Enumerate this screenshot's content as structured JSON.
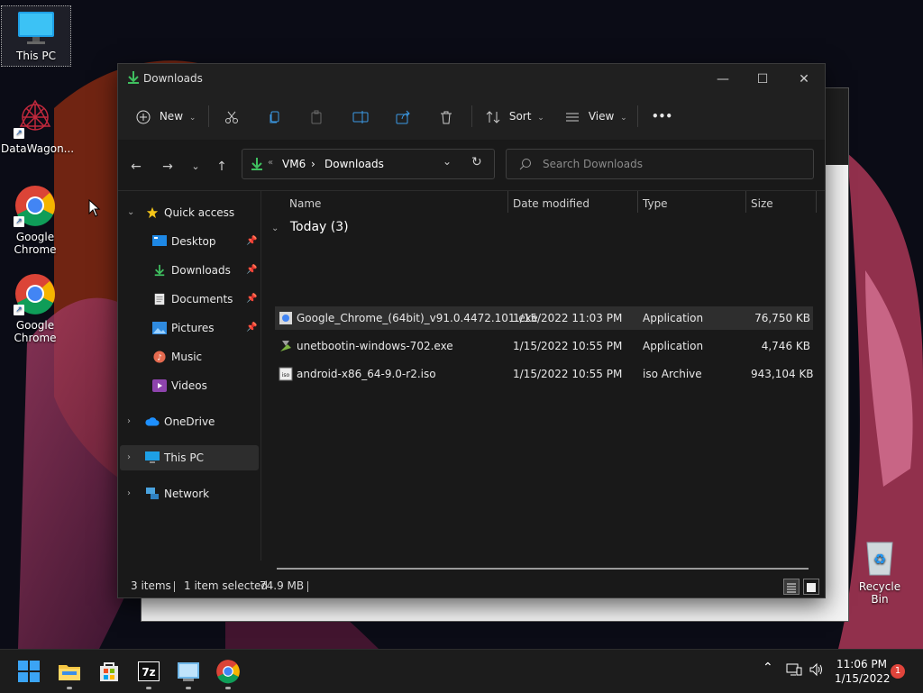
{
  "desktop": {
    "icons": [
      {
        "label": "This PC"
      },
      {
        "label": "DataWagon..."
      },
      {
        "label": "Google Chrome"
      },
      {
        "label": "Google Chrome"
      },
      {
        "label": "Recycle Bin"
      }
    ]
  },
  "window": {
    "title": "Downloads",
    "controls": {
      "minimize": "—",
      "maximize": "☐",
      "close": "✕"
    }
  },
  "toolbar": {
    "new_label": "New",
    "sort_label": "Sort",
    "view_label": "View",
    "more_label": "•••"
  },
  "address": {
    "crumbs": [
      "VM6",
      "Downloads"
    ],
    "separator": "›",
    "overflow": "«"
  },
  "search": {
    "placeholder": "Search Downloads"
  },
  "sidebar": {
    "quick_access": "Quick access",
    "items": [
      {
        "label": "Desktop",
        "pinned": true
      },
      {
        "label": "Downloads",
        "pinned": true
      },
      {
        "label": "Documents",
        "pinned": true
      },
      {
        "label": "Pictures",
        "pinned": true
      },
      {
        "label": "Music",
        "pinned": false
      },
      {
        "label": "Videos",
        "pinned": false
      }
    ],
    "onedrive": "OneDrive",
    "this_pc": "This PC",
    "network": "Network"
  },
  "columns": {
    "name": "Name",
    "date": "Date modified",
    "type": "Type",
    "size": "Size"
  },
  "group": {
    "label": "Today (3)"
  },
  "files": [
    {
      "name": "Google_Chrome_(64bit)_v91.0.4472.101.exe",
      "date": "1/15/2022 11:03 PM",
      "type": "Application",
      "size": "76,750 KB",
      "selected": true
    },
    {
      "name": "unetbootin-windows-702.exe",
      "date": "1/15/2022 10:55 PM",
      "type": "Application",
      "size": "4,746 KB",
      "selected": false
    },
    {
      "name": "android-x86_64-9.0-r2.iso",
      "date": "1/15/2022 10:55 PM",
      "type": "iso Archive",
      "size": "943,104 KB",
      "selected": false
    }
  ],
  "status": {
    "items": "3 items",
    "selected": "1 item selected",
    "size": "74.9 MB"
  },
  "taskbar": {
    "time": "11:06 PM",
    "date": "1/15/2022",
    "notifications": "1",
    "apps": [
      "start",
      "file-explorer",
      "microsoft-store",
      "7zip",
      "control-panel",
      "google-chrome"
    ]
  },
  "colors": {
    "accent": "#0078d4",
    "window_bg": "#191919",
    "selected_row": "#2e2e2e"
  }
}
